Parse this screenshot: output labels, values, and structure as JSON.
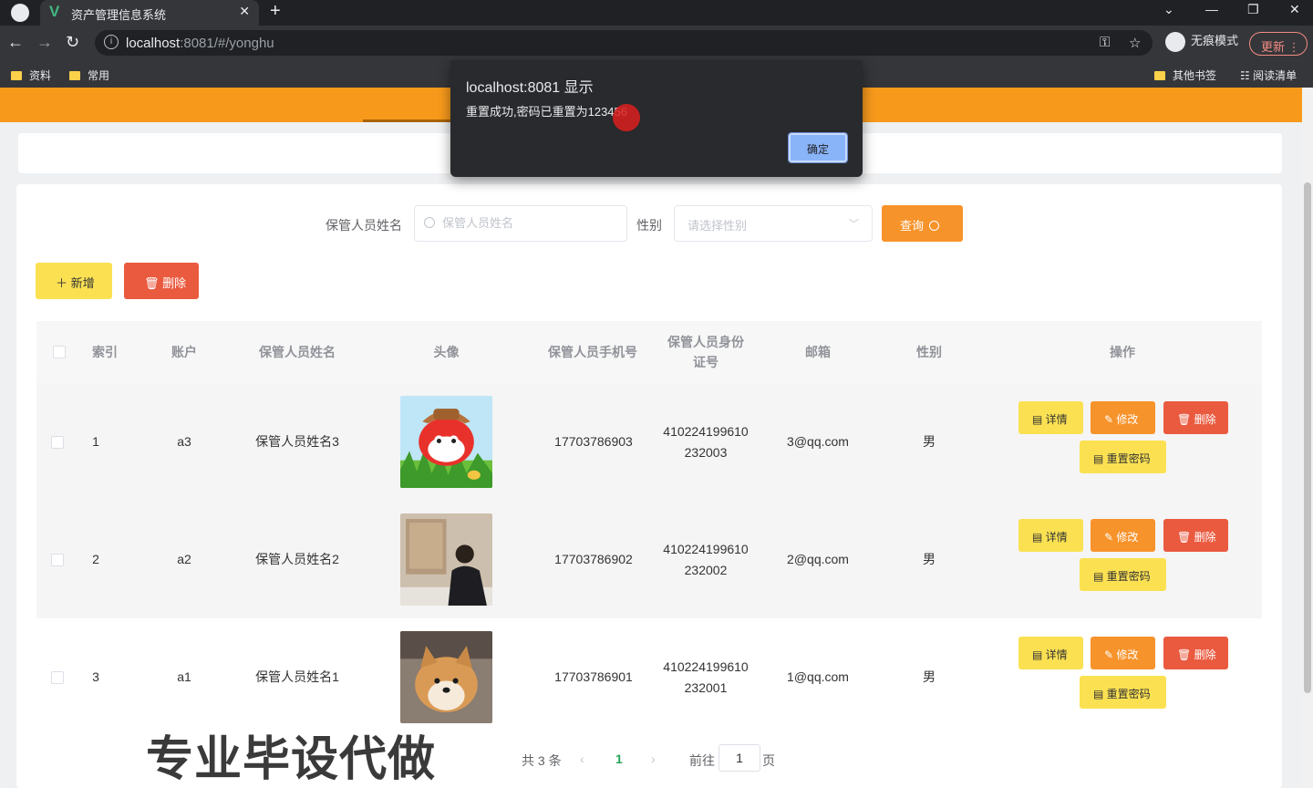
{
  "browser": {
    "tab_title": "资产管理信息系统",
    "url_host": "localhost",
    "url_rest": ":8081/#/yonghu",
    "incognito_label": "无痕模式",
    "update_label": "更新",
    "bookmarks": [
      "资料",
      "常用"
    ],
    "bookmarks_right": [
      "其他书签",
      "阅读清单"
    ]
  },
  "dialog": {
    "title": "localhost:8081 显示",
    "message": "重置成功,密码已重置为123456",
    "ok_label": "确定"
  },
  "search": {
    "name_label": "保管人员姓名",
    "name_placeholder": "保管人员姓名",
    "gender_label": "性别",
    "gender_placeholder": "请选择性别",
    "query_label": "查询"
  },
  "actions": {
    "add_label": "新增",
    "delete_label": "删除"
  },
  "table": {
    "headers": [
      "索引",
      "账户",
      "保管人员姓名",
      "头像",
      "保管人员手机号",
      "保管人员身份证号",
      "邮箱",
      "性别",
      "操作"
    ],
    "rows": [
      {
        "index": "1",
        "account": "a3",
        "name": "保管人员姓名3",
        "phone": "17703786903",
        "id_line1": "410224199610",
        "id_line2": "232003",
        "email": "3@qq.com",
        "gender": "男"
      },
      {
        "index": "2",
        "account": "a2",
        "name": "保管人员姓名2",
        "phone": "17703786902",
        "id_line1": "410224199610",
        "id_line2": "232002",
        "email": "2@qq.com",
        "gender": "男"
      },
      {
        "index": "3",
        "account": "a1",
        "name": "保管人员姓名1",
        "phone": "17703786901",
        "id_line1": "410224199610",
        "id_line2": "232001",
        "email": "1@qq.com",
        "gender": "男"
      }
    ],
    "row_actions": {
      "detail": "详情",
      "edit": "修改",
      "delete": "删除",
      "reset": "重置密码"
    }
  },
  "pagination": {
    "total": "共 3 条",
    "current": "1",
    "goto_prefix": "前往",
    "goto_value": "1",
    "goto_suffix": "页"
  },
  "watermark": "专业毕设代做"
}
